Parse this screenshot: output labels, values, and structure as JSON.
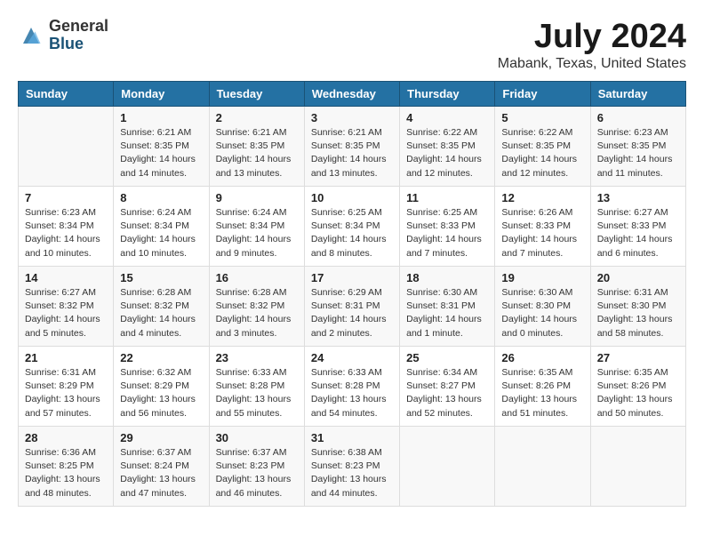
{
  "logo": {
    "general": "General",
    "blue": "Blue"
  },
  "title": "July 2024",
  "location": "Mabank, Texas, United States",
  "weekdays": [
    "Sunday",
    "Monday",
    "Tuesday",
    "Wednesday",
    "Thursday",
    "Friday",
    "Saturday"
  ],
  "weeks": [
    [
      {
        "day": "",
        "info": ""
      },
      {
        "day": "1",
        "info": "Sunrise: 6:21 AM\nSunset: 8:35 PM\nDaylight: 14 hours\nand 14 minutes."
      },
      {
        "day": "2",
        "info": "Sunrise: 6:21 AM\nSunset: 8:35 PM\nDaylight: 14 hours\nand 13 minutes."
      },
      {
        "day": "3",
        "info": "Sunrise: 6:21 AM\nSunset: 8:35 PM\nDaylight: 14 hours\nand 13 minutes."
      },
      {
        "day": "4",
        "info": "Sunrise: 6:22 AM\nSunset: 8:35 PM\nDaylight: 14 hours\nand 12 minutes."
      },
      {
        "day": "5",
        "info": "Sunrise: 6:22 AM\nSunset: 8:35 PM\nDaylight: 14 hours\nand 12 minutes."
      },
      {
        "day": "6",
        "info": "Sunrise: 6:23 AM\nSunset: 8:35 PM\nDaylight: 14 hours\nand 11 minutes."
      }
    ],
    [
      {
        "day": "7",
        "info": "Sunrise: 6:23 AM\nSunset: 8:34 PM\nDaylight: 14 hours\nand 10 minutes."
      },
      {
        "day": "8",
        "info": "Sunrise: 6:24 AM\nSunset: 8:34 PM\nDaylight: 14 hours\nand 10 minutes."
      },
      {
        "day": "9",
        "info": "Sunrise: 6:24 AM\nSunset: 8:34 PM\nDaylight: 14 hours\nand 9 minutes."
      },
      {
        "day": "10",
        "info": "Sunrise: 6:25 AM\nSunset: 8:34 PM\nDaylight: 14 hours\nand 8 minutes."
      },
      {
        "day": "11",
        "info": "Sunrise: 6:25 AM\nSunset: 8:33 PM\nDaylight: 14 hours\nand 7 minutes."
      },
      {
        "day": "12",
        "info": "Sunrise: 6:26 AM\nSunset: 8:33 PM\nDaylight: 14 hours\nand 7 minutes."
      },
      {
        "day": "13",
        "info": "Sunrise: 6:27 AM\nSunset: 8:33 PM\nDaylight: 14 hours\nand 6 minutes."
      }
    ],
    [
      {
        "day": "14",
        "info": "Sunrise: 6:27 AM\nSunset: 8:32 PM\nDaylight: 14 hours\nand 5 minutes."
      },
      {
        "day": "15",
        "info": "Sunrise: 6:28 AM\nSunset: 8:32 PM\nDaylight: 14 hours\nand 4 minutes."
      },
      {
        "day": "16",
        "info": "Sunrise: 6:28 AM\nSunset: 8:32 PM\nDaylight: 14 hours\nand 3 minutes."
      },
      {
        "day": "17",
        "info": "Sunrise: 6:29 AM\nSunset: 8:31 PM\nDaylight: 14 hours\nand 2 minutes."
      },
      {
        "day": "18",
        "info": "Sunrise: 6:30 AM\nSunset: 8:31 PM\nDaylight: 14 hours\nand 1 minute."
      },
      {
        "day": "19",
        "info": "Sunrise: 6:30 AM\nSunset: 8:30 PM\nDaylight: 14 hours\nand 0 minutes."
      },
      {
        "day": "20",
        "info": "Sunrise: 6:31 AM\nSunset: 8:30 PM\nDaylight: 13 hours\nand 58 minutes."
      }
    ],
    [
      {
        "day": "21",
        "info": "Sunrise: 6:31 AM\nSunset: 8:29 PM\nDaylight: 13 hours\nand 57 minutes."
      },
      {
        "day": "22",
        "info": "Sunrise: 6:32 AM\nSunset: 8:29 PM\nDaylight: 13 hours\nand 56 minutes."
      },
      {
        "day": "23",
        "info": "Sunrise: 6:33 AM\nSunset: 8:28 PM\nDaylight: 13 hours\nand 55 minutes."
      },
      {
        "day": "24",
        "info": "Sunrise: 6:33 AM\nSunset: 8:28 PM\nDaylight: 13 hours\nand 54 minutes."
      },
      {
        "day": "25",
        "info": "Sunrise: 6:34 AM\nSunset: 8:27 PM\nDaylight: 13 hours\nand 52 minutes."
      },
      {
        "day": "26",
        "info": "Sunrise: 6:35 AM\nSunset: 8:26 PM\nDaylight: 13 hours\nand 51 minutes."
      },
      {
        "day": "27",
        "info": "Sunrise: 6:35 AM\nSunset: 8:26 PM\nDaylight: 13 hours\nand 50 minutes."
      }
    ],
    [
      {
        "day": "28",
        "info": "Sunrise: 6:36 AM\nSunset: 8:25 PM\nDaylight: 13 hours\nand 48 minutes."
      },
      {
        "day": "29",
        "info": "Sunrise: 6:37 AM\nSunset: 8:24 PM\nDaylight: 13 hours\nand 47 minutes."
      },
      {
        "day": "30",
        "info": "Sunrise: 6:37 AM\nSunset: 8:23 PM\nDaylight: 13 hours\nand 46 minutes."
      },
      {
        "day": "31",
        "info": "Sunrise: 6:38 AM\nSunset: 8:23 PM\nDaylight: 13 hours\nand 44 minutes."
      },
      {
        "day": "",
        "info": ""
      },
      {
        "day": "",
        "info": ""
      },
      {
        "day": "",
        "info": ""
      }
    ]
  ]
}
